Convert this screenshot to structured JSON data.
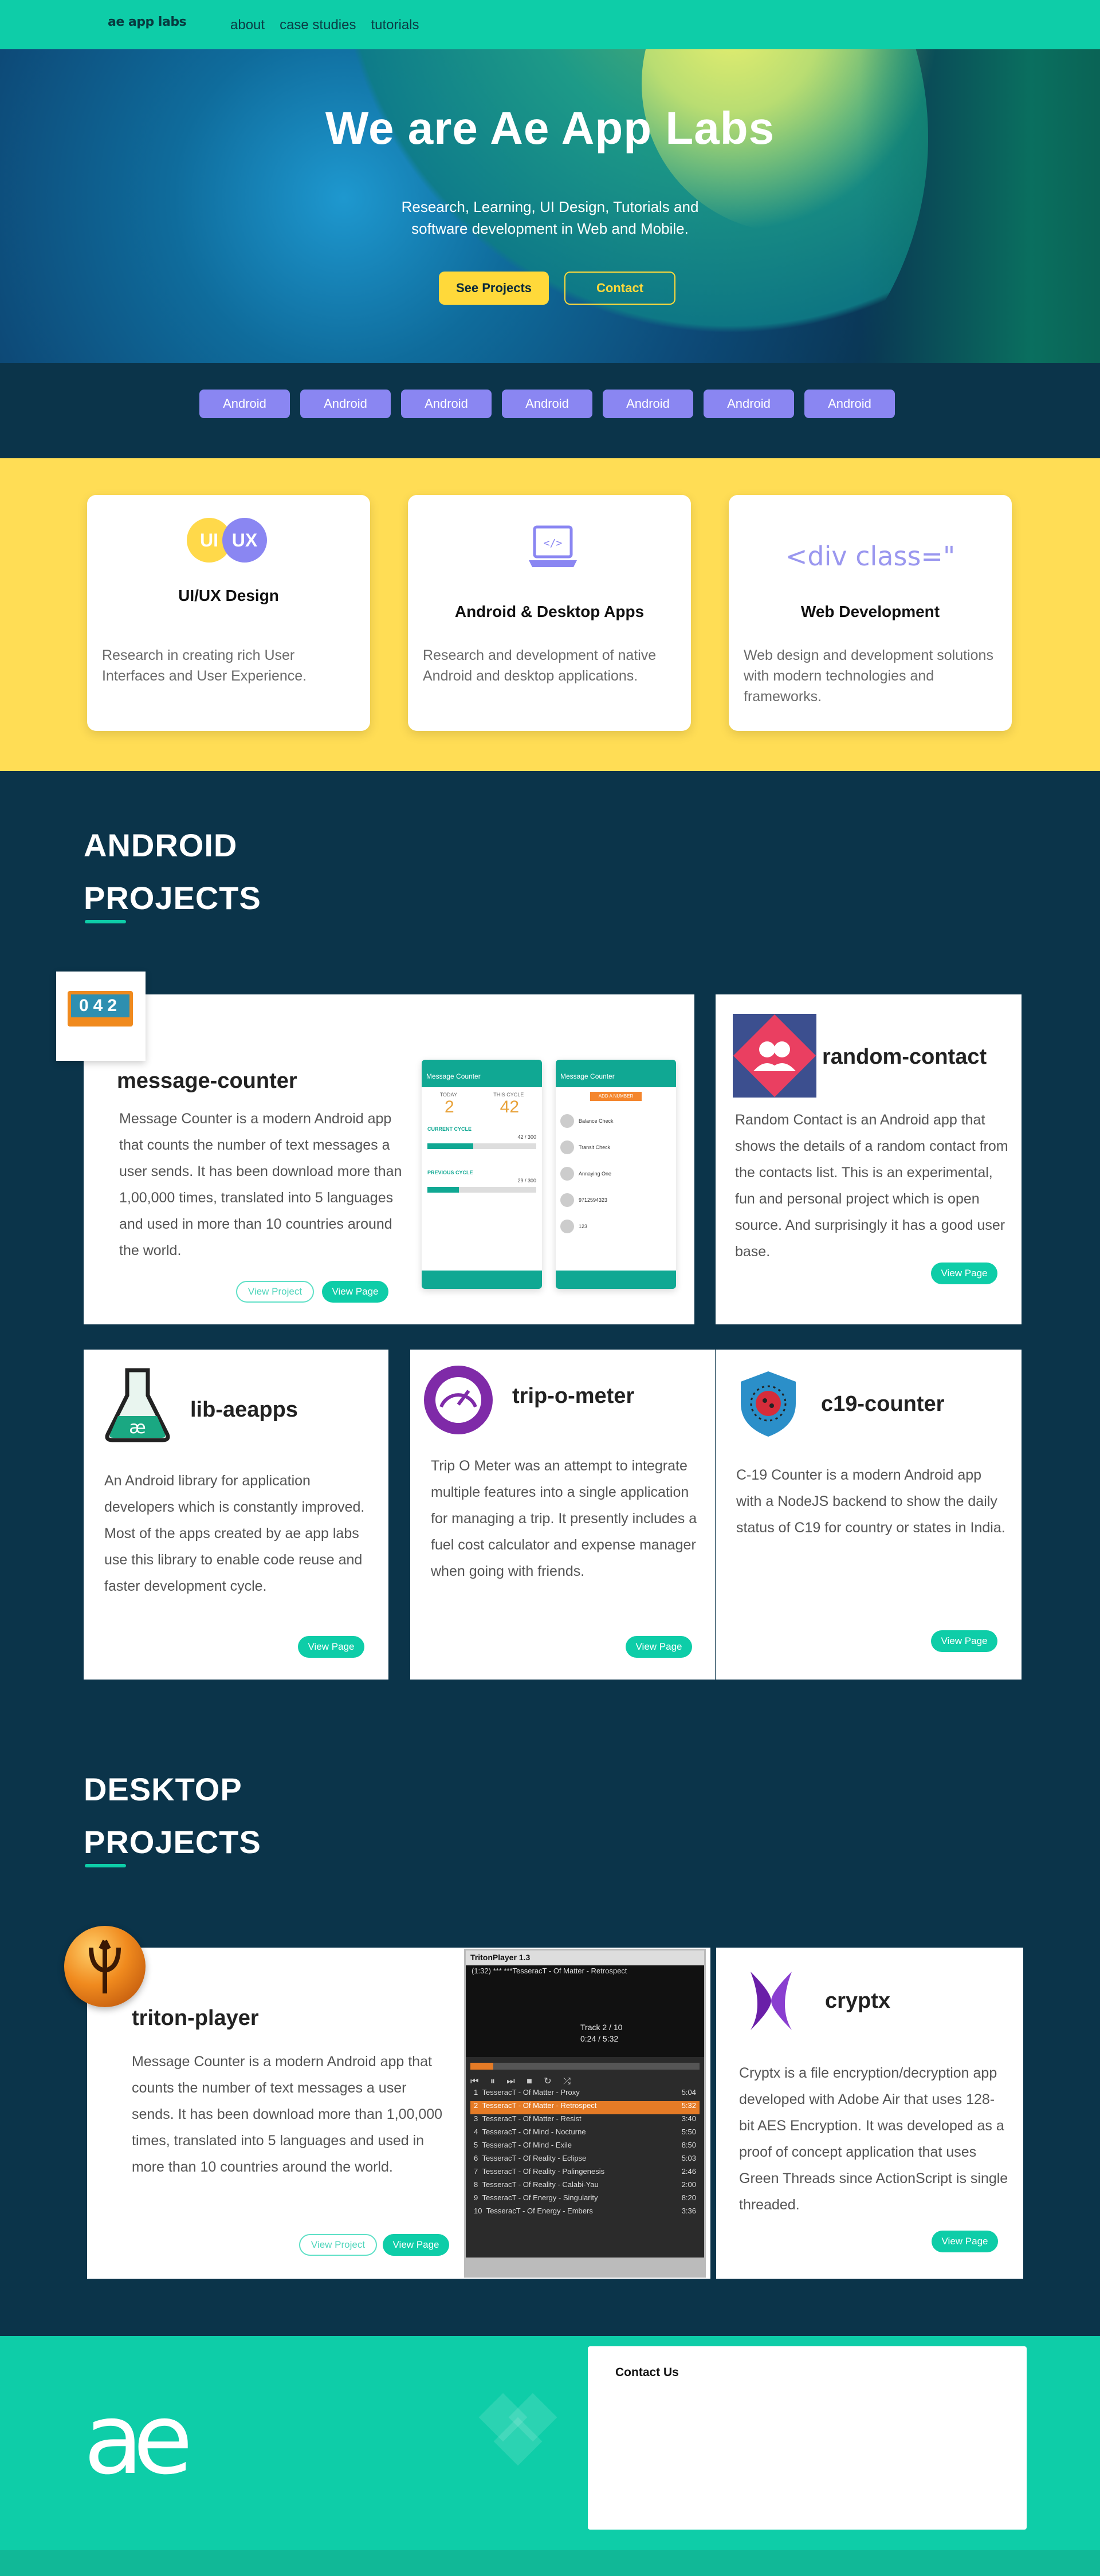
{
  "nav": {
    "logo": "ae app labs",
    "links": [
      "about",
      "case studies",
      "tutorials"
    ]
  },
  "hero": {
    "title": "We are Ae App Labs",
    "subtitle": "Research, Learning, UI Design, Tutorials and software development in Web and Mobile.",
    "see_projects": "See Projects",
    "contact": "Contact"
  },
  "tags": [
    "Android",
    "Android",
    "Android",
    "Android",
    "Android",
    "Android",
    "Android"
  ],
  "services": [
    {
      "icon": "ui-ux-icon",
      "icon_text_1": "UI",
      "icon_text_2": "UX",
      "title": "UI/UX Design",
      "desc": "Research in creating rich User Interfaces and User Experience."
    },
    {
      "icon": "laptop-code-icon",
      "title": "Android & Desktop Apps",
      "desc": "Research and development of native Android and desktop applications."
    },
    {
      "icon": "div-class-icon",
      "icon_text": "<div class=\"",
      "title": "Web Development",
      "desc": "Web design and development solutions with modern technologies and frameworks."
    }
  ],
  "android_heading": [
    "ANDROID",
    "PROJECTS"
  ],
  "desktop_heading": [
    "DESKTOP",
    "PROJECTS"
  ],
  "labels": {
    "view_project": "View Project",
    "view_page": "View Page"
  },
  "android_projects": [
    {
      "name": "message-counter",
      "badge": "042",
      "desc": "Message Counter is a modern Android app that counts the number of text messages a user sends. It has been download more than 1,00,000 times, translated into 5 languages and used in more than 10 countries around the world."
    },
    {
      "name": "random-contact",
      "desc": "Random Contact is an Android app that shows the details of a random contact from the contacts list. This is an experimental, fun and personal project which is open source. And surprisingly it has a good user base."
    },
    {
      "name": "lib-aeapps",
      "desc": "An Android library for application developers which is constantly improved. Most of the apps created by ae app labs use this library to enable code reuse and faster development cycle."
    },
    {
      "name": "trip-o-meter",
      "desc": "Trip O Meter was an attempt to integrate multiple features into a single application for managing a trip. It presently includes a fuel cost calculator and expense manager when going with friends."
    },
    {
      "name": "c19-counter",
      "desc": "C-19 Counter is a modern Android app with a NodeJS backend to show the daily status of C19 for country or states in India."
    }
  ],
  "phone1": {
    "title": "Message Counter",
    "today_label": "TODAY",
    "cycle_label": "THIS CYCLE",
    "today_value": "2",
    "cycle_value": "42",
    "current_cycle": "CURRENT CYCLE",
    "prev_cycle": "PREVIOUS CYCLE",
    "count": "42 / 300",
    "prev_count": "29 / 300"
  },
  "phone2": {
    "title": "Message Counter",
    "button": "ADD A NUMBER",
    "contacts": [
      "Balance Check",
      "Transit Check",
      "Annaying One",
      "9712594323",
      "123"
    ]
  },
  "desktop_projects": [
    {
      "name": "triton-player",
      "desc": "Message Counter is a modern Android app that counts the number of text messages a user sends. It has been download more than 1,00,000 times, translated into 5 languages and used in more than 10 countries around the world."
    },
    {
      "name": "cryptx",
      "desc": "Cryptx is a file encryption/decryption app developed with Adobe Air that uses 128-bit AES Encryption. It was developed as a proof of concept application that uses Green Threads since ActionScript is single threaded."
    }
  ],
  "triton": {
    "title": "TritonPlayer 1.3",
    "now_playing": "(1:32) *** ***TesseracT - Of Matter - Retrospect",
    "track": "Track 2 / 10",
    "time": "0:24 / 5:32",
    "playlist": [
      {
        "n": "1",
        "t": "TesseracT - Of Matter - Proxy",
        "d": "5:04"
      },
      {
        "n": "2",
        "t": "TesseracT - Of Matter - Retrospect",
        "d": "5:32"
      },
      {
        "n": "3",
        "t": "TesseracT - Of Matter - Resist",
        "d": "3:40"
      },
      {
        "n": "4",
        "t": "TesseracT - Of Mind - Nocturne",
        "d": "5:50"
      },
      {
        "n": "5",
        "t": "TesseracT - Of Mind - Exile",
        "d": "8:50"
      },
      {
        "n": "6",
        "t": "TesseracT - Of Reality - Eclipse",
        "d": "5:03"
      },
      {
        "n": "7",
        "t": "TesseracT - Of Reality - Palingenesis",
        "d": "2:46"
      },
      {
        "n": "8",
        "t": "TesseracT - Of Reality - Calabi-Yau",
        "d": "2:00"
      },
      {
        "n": "9",
        "t": "TesseracT - Of Energy - Singularity",
        "d": "8:20"
      },
      {
        "n": "10",
        "t": "TesseracT - Of Energy - Embers",
        "d": "3:36"
      }
    ]
  },
  "footer": {
    "logo": "ae",
    "contact_title": "Contact Us"
  },
  "colors": {
    "teal": "#0ecda8",
    "navy": "#0b344a",
    "yellow": "#ffdd55",
    "purple": "#8a86f2"
  }
}
